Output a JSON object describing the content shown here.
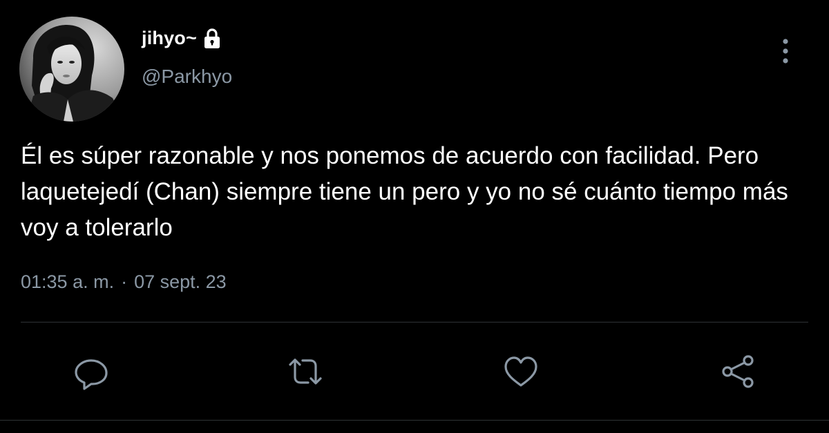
{
  "user": {
    "display_name": "jihyo~",
    "handle": "@Parkhyo",
    "protected_icon": "lock-icon",
    "avatar_icon": "profile-photo"
  },
  "tweet": {
    "text": "Él es súper razonable y nos ponemos de acuerdo con facilidad. Pero laquetejedí (Chan) siempre tiene un pero y yo no sé cuánto tiempo más voy a tolerarlo",
    "time": "01:35 a. m.",
    "separator": "·",
    "date": "07 sept. 23"
  },
  "actions": {
    "reply_icon": "reply-icon",
    "retweet_icon": "retweet-icon",
    "like_icon": "heart-icon",
    "share_icon": "share-icon",
    "more_icon": "more-vertical-icon"
  },
  "colors": {
    "background": "#000000",
    "primary_text": "#ffffff",
    "secondary_text": "#8b98a5",
    "icon": "#8b98a5",
    "divider": "#2f3336"
  }
}
